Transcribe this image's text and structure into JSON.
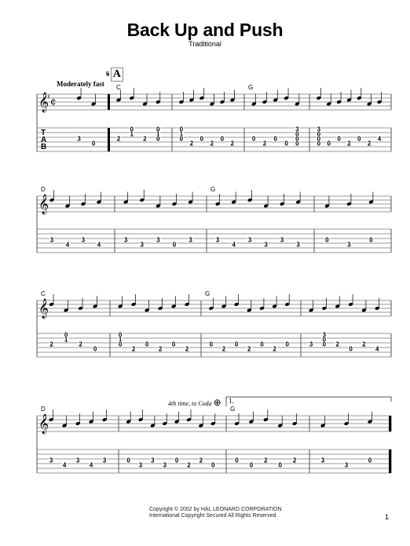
{
  "header": {
    "title": "Back Up and Push",
    "composer": "Traditional"
  },
  "markings": {
    "segno": "𝄋",
    "rehearsal_letter": "A",
    "tempo": "Moderately fast",
    "coda_instruction": "4th time, to Coda",
    "coda_symbol": "⊕",
    "first_ending": "1."
  },
  "tab_clef": [
    "T",
    "A",
    "B"
  ],
  "systems": [
    {
      "chords": [
        {
          "measure": 1,
          "label": "C"
        },
        {
          "measure": 3,
          "label": "G"
        }
      ],
      "measures": [
        {
          "tab": [
            [
              "3"
            ],
            [
              "0"
            ]
          ]
        },
        {
          "tab": [
            [
              "2"
            ],
            [
              "0",
              "1"
            ],
            [
              "2"
            ],
            [
              "0",
              "1",
              "0"
            ]
          ]
        },
        {
          "tab": [
            [
              "0",
              "1",
              "0"
            ],
            [
              "2"
            ],
            [
              "0"
            ],
            [
              "2"
            ],
            [
              "0"
            ],
            [
              "2"
            ]
          ]
        },
        {
          "tab": [
            [
              "0"
            ],
            [
              "2"
            ],
            [
              "0"
            ],
            [
              "0"
            ],
            [
              "3",
              "0",
              "0",
              "0"
            ]
          ]
        },
        {
          "tab": [
            [
              "3",
              "0",
              "0",
              "0"
            ],
            [
              "0"
            ],
            [
              "0"
            ],
            [
              "2"
            ],
            [
              "0"
            ],
            [
              "2"
            ],
            [
              "4"
            ]
          ]
        }
      ]
    },
    {
      "chords": [
        {
          "measure": 0,
          "label": "D"
        },
        {
          "measure": 2,
          "label": "G"
        }
      ],
      "measures": [
        {
          "tab": [
            [
              "3"
            ],
            [
              "4"
            ],
            [
              "3"
            ],
            [
              "4"
            ]
          ]
        },
        {
          "tab": [
            [
              "3"
            ],
            [
              "3"
            ],
            [
              "3"
            ],
            [
              "0"
            ],
            [
              "3"
            ]
          ]
        },
        {
          "tab": [
            [
              "3"
            ],
            [
              "4"
            ],
            [
              "3"
            ],
            [
              "3"
            ],
            [
              "3"
            ],
            [
              "3"
            ]
          ]
        },
        {
          "tab": [
            [
              "0"
            ],
            [
              "3"
            ],
            [
              "0"
            ]
          ]
        }
      ]
    },
    {
      "chords": [
        {
          "measure": 0,
          "label": "C"
        },
        {
          "measure": 2,
          "label": "G"
        }
      ],
      "measures": [
        {
          "tab": [
            [
              "2"
            ],
            [
              "0",
              "1"
            ],
            [
              "2"
            ],
            [
              "0"
            ]
          ]
        },
        {
          "tab": [
            [
              "0",
              "1",
              "0"
            ],
            [
              "2"
            ],
            [
              "0"
            ],
            [
              "2"
            ],
            [
              "0"
            ],
            [
              "2"
            ]
          ]
        },
        {
          "tab": [
            [
              "0"
            ],
            [
              "2"
            ],
            [
              "0"
            ],
            [
              "2"
            ],
            [
              "0"
            ],
            [
              "2"
            ],
            [
              "0"
            ]
          ]
        },
        {
          "tab": [
            [
              "3"
            ],
            [
              "3",
              "0",
              "0"
            ],
            [
              "2"
            ],
            [
              "0"
            ],
            [
              "2"
            ],
            [
              "4"
            ]
          ]
        }
      ]
    },
    {
      "chords": [
        {
          "measure": 0,
          "label": "D"
        },
        {
          "measure": 2,
          "label": "G"
        }
      ],
      "measures": [
        {
          "tab": [
            [
              "3"
            ],
            [
              "4"
            ],
            [
              "3"
            ],
            [
              "4"
            ],
            [
              "3"
            ]
          ]
        },
        {
          "tab": [
            [
              "0"
            ],
            [
              "3"
            ],
            [
              "3"
            ],
            [
              "3"
            ],
            [
              "0"
            ],
            [
              "2"
            ],
            [
              "2"
            ],
            [
              "0"
            ]
          ]
        },
        {
          "tab": [
            [
              "0"
            ],
            [
              "0"
            ],
            [
              "2"
            ],
            [
              "0"
            ],
            [
              "2"
            ]
          ]
        },
        {
          "tab": [
            [
              "3"
            ],
            [
              "3"
            ],
            [
              "0"
            ]
          ]
        }
      ]
    }
  ],
  "footer": {
    "line1": "Copyright © 2002 by HAL LEONARD CORPORATION",
    "line2": "International Copyright Secured   All Rights Reserved",
    "page_number": "1"
  }
}
